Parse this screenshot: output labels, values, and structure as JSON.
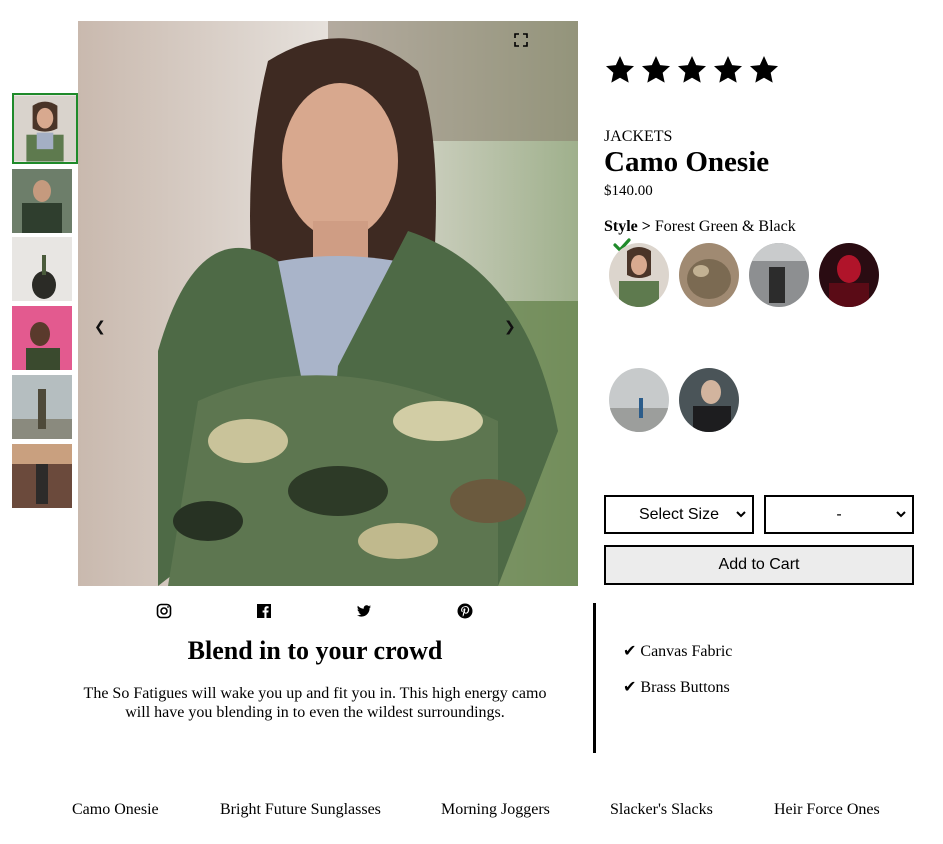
{
  "rating": {
    "stars": 5,
    "max": 5
  },
  "product": {
    "category": "JACKETS",
    "name": "Camo Onesie",
    "price": "$140.00",
    "style_label": "Style >",
    "style_value": "Forest Green & Black"
  },
  "controls": {
    "size_select": "Select Size",
    "qty_select": "-",
    "add_to_cart": "Add to Cart"
  },
  "social": [
    "instagram-icon",
    "facebook-icon",
    "twitter-icon",
    "pinterest-icon"
  ],
  "description": {
    "headline": "Blend in to your crowd",
    "body": "The So Fatigues will wake you up and fit you in. This high energy camo will have you blending in to even the wildest surroundings."
  },
  "features": [
    "Canvas Fabric",
    "Brass Buttons"
  ],
  "footer_links": [
    "Camo Onesie",
    "Bright Future Sunglasses",
    "Morning Joggers",
    "Slacker's Slacks",
    "Heir Force Ones"
  ],
  "colors": {
    "accent": "#1f8a2a",
    "button_bg": "#ececec"
  }
}
